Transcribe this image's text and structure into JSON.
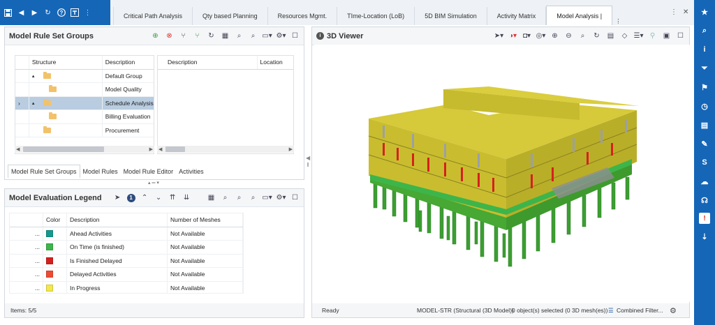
{
  "quick_toolbar": {
    "icons": [
      "save-icon",
      "back-icon",
      "forward-icon",
      "refresh-icon",
      "help-icon",
      "export-icon",
      "more-icon"
    ]
  },
  "tabs": [
    {
      "label": "Critical Path Analysis",
      "active": false
    },
    {
      "label": "Qty based Planning",
      "active": false
    },
    {
      "label": "Resources Mgmt.",
      "active": false
    },
    {
      "label": "TIme-Location (LoB)",
      "active": false
    },
    {
      "label": "5D BIM Simulation",
      "active": false
    },
    {
      "label": "Activity Matrix",
      "active": false
    },
    {
      "label": "Model Analysis |",
      "active": true
    }
  ],
  "rule_sets": {
    "title": "Model Rule Set Groups",
    "columns": {
      "structure": "Structure",
      "description": "Description"
    },
    "rows": [
      {
        "expander": "▴",
        "description": "Default Group",
        "level": 0,
        "selected": false
      },
      {
        "expander": "",
        "description": "Model Quality",
        "level": 1,
        "selected": false
      },
      {
        "expander": "▴",
        "description": "Schedule Analysis (I",
        "level": 0,
        "selected": true
      },
      {
        "expander": "",
        "description": "Billing Evaluation",
        "level": 1,
        "selected": false
      },
      {
        "expander": "",
        "description": "Procurement",
        "level": 0,
        "selected": false
      }
    ],
    "detail_columns": {
      "description": "Description",
      "location": "Location"
    },
    "subtabs": [
      {
        "label": "Model Rule Set Groups",
        "active": true
      },
      {
        "label": "Model Rules",
        "active": false
      },
      {
        "label": "Model Rule Editor",
        "active": false
      },
      {
        "label": "Activities",
        "active": false
      }
    ]
  },
  "legend": {
    "title": "Model Evaluation Legend",
    "badge": "1",
    "columns": {
      "color": "Color",
      "description": "Description",
      "meshes": "Number of Meshes"
    },
    "rows": [
      {
        "dots": "...",
        "color": "#14998e",
        "description": "Ahead Activities",
        "meshes": "Not Available"
      },
      {
        "dots": "...",
        "color": "#3db54a",
        "description": "On Time (is finished)",
        "meshes": "Not Available"
      },
      {
        "dots": "...",
        "color": "#d4211d",
        "description": "Is Finished Delayed",
        "meshes": "Not Available"
      },
      {
        "dots": "...",
        "color": "#ee4b34",
        "description": "Delayed Activities",
        "meshes": "Not Available"
      },
      {
        "dots": "...",
        "color": "#f2e84a",
        "description": "In Progress",
        "meshes": "Not Available"
      }
    ],
    "status": "Items: 5/5"
  },
  "viewer": {
    "title": "3D Viewer",
    "status": {
      "state": "Ready",
      "model": "MODEL-STR (Structural (3D Model))",
      "selection": "0 object(s) selected (0 3D mesh(es))",
      "filter": "Combined Filter..."
    }
  },
  "right_sidebar": {
    "icons": [
      "star-add-icon",
      "search-icon",
      "info-icon",
      "filter-icon",
      "flag-icon",
      "clock-icon",
      "document-icon",
      "tools-icon",
      "skype-icon",
      "cloud-icon",
      "support-icon",
      "alert-icon",
      "download-icon"
    ]
  },
  "colors": {
    "brand": "#1566b7",
    "selection": "#b9cce0"
  }
}
